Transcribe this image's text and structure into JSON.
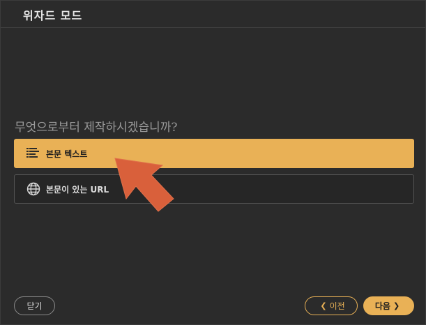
{
  "window": {
    "title": "위자드 모드"
  },
  "prompt": {
    "question": "무엇으로부터 제작하시겠습니까?"
  },
  "options": [
    {
      "label": "본문 텍스트",
      "icon": "text-lines-icon",
      "selected": true
    },
    {
      "label": "본문이 있는 URL",
      "icon": "globe-icon",
      "selected": false
    }
  ],
  "footer": {
    "close_label": "닫기",
    "prev_label": "이전",
    "next_label": "다음"
  },
  "colors": {
    "accent": "#e9b156",
    "background": "#2b2b2b",
    "annotation_arrow": "#d9603b"
  }
}
